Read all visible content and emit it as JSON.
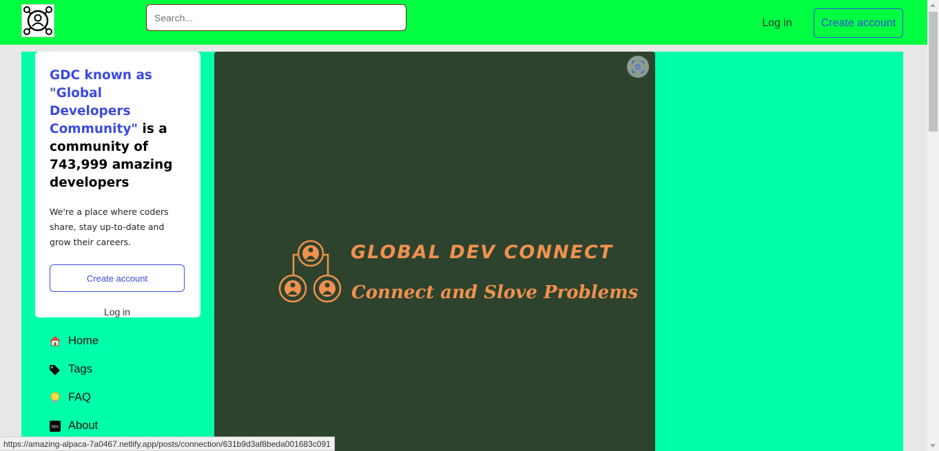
{
  "header": {
    "search_placeholder": "Search...",
    "login_label": "Log in",
    "create_account_label": "Create account",
    "background_color": "#00ff40"
  },
  "intro_card": {
    "title_highlight": "GDC known as \"Global Developers Community\"",
    "title_rest": " is a community of 743,999 amazing developers",
    "description": "We're a place where coders share, stay up-to-date and grow their careers.",
    "create_account_label": "Create account",
    "login_label": "Log in",
    "accent_color": "#3b49df"
  },
  "sidebar_nav": {
    "items": [
      {
        "label": "Home",
        "icon": "house-icon"
      },
      {
        "label": "Tags",
        "icon": "tag-icon"
      },
      {
        "label": "FAQ",
        "icon": "lightbulb-icon"
      },
      {
        "label": "About",
        "icon": "dev-badge-icon"
      }
    ]
  },
  "banner": {
    "title": "GLOBAL DEV CONNECT",
    "subtitle": "Connect and Slove Problems",
    "background_color": "#2d432d",
    "text_color": "#f0914f"
  },
  "main": {
    "background_color": "#00ffaa"
  },
  "status_bar": {
    "url": "https://amazing-alpaca-7a0467.netlify.app/posts/connection/631b9d3af8beda001683c091"
  }
}
